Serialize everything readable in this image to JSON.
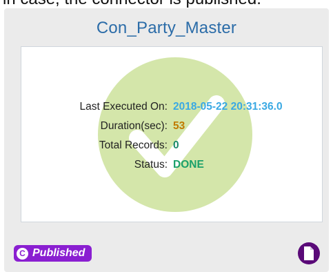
{
  "caption_text": "in case, the connector is published.",
  "card": {
    "title": "Con_Party_Master",
    "details": [
      {
        "label": "Last Executed On:",
        "value": "2018-05-22 20:31:36.0",
        "color": "#3aa9e3"
      },
      {
        "label": "Duration(sec):",
        "value": "53",
        "color": "#c07a00"
      },
      {
        "label": "Total Records:",
        "value": "0",
        "color": "#1a8a6a"
      },
      {
        "label": "Status:",
        "value": "DONE",
        "color": "#1aa06a"
      }
    ],
    "watermark_icon": "checkmark-circle-icon",
    "watermark_color": "#c5dd8e",
    "badge": {
      "icon": "copyright-icon",
      "icon_glyph": "C",
      "label": "Published",
      "color": "#8a1fd1"
    },
    "document_button": {
      "icon": "document-icon",
      "color": "#5a0a78"
    }
  }
}
